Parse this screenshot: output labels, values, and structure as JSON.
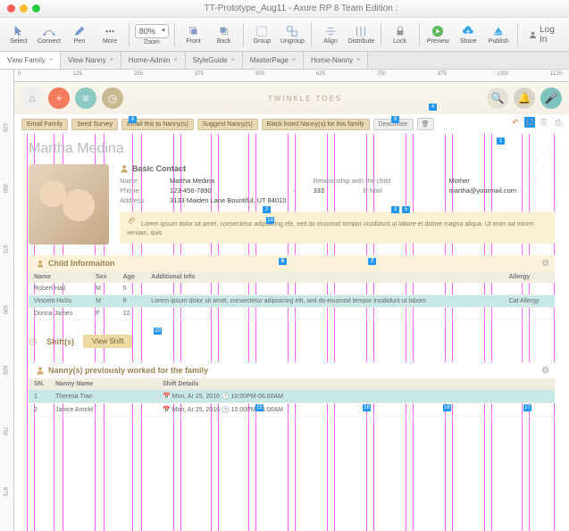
{
  "window": {
    "title": "TT-Prototype_Aug11 - Axure RP 8 Team Edition :"
  },
  "toolbar": {
    "select": "Select",
    "connect": "Connect",
    "pen": "Pen",
    "more": "More",
    "zoom": "80%",
    "zoom_lbl": "Zoom",
    "front": "Front",
    "back": "Back",
    "group": "Group",
    "ungroup": "Ungroup",
    "align": "Align",
    "distribute": "Distribute",
    "lock": "Lock",
    "preview": "Preview",
    "share": "Share",
    "publish": "Publish",
    "login": "Log In"
  },
  "tabs": [
    "View Family",
    "View Nanny",
    "Home-Admin",
    "StyleGuide",
    "MasterPage",
    "Home-Nanny"
  ],
  "ruler_h": [
    "0",
    "125",
    "250",
    "375",
    "500",
    "625",
    "750",
    "875",
    "1000",
    "1125"
  ],
  "ruler_v": [
    "125",
    "250",
    "375",
    "500",
    "625",
    "750",
    "875"
  ],
  "brand": "TWINKLE TOES",
  "action_buttons": {
    "email_family": "Email Family",
    "send_survey": "Send Survey",
    "email_nanny": "Email this to Nanny(s)",
    "suggest": "Suggest Nanny(s)",
    "blacklist": "Black listed Nanny(s) for this family",
    "deactivate": "Deactivate"
  },
  "person": {
    "name": "Martha Medina"
  },
  "basic": {
    "title": "Basic Contact",
    "name_lbl": "Name",
    "name": "Martha Medina",
    "rel_lbl": "Relationship with the child",
    "rel": "Mother",
    "phone_lbl": "Phone",
    "phone": "123-456-7890",
    "phone_sep": "-",
    "phone_ext": "333",
    "email_lbl": "E-Mail",
    "email": "martha@yourmail.com",
    "addr_lbl": "Address",
    "addr": "3133 Maiden Lane   Bountiful, UT 84010"
  },
  "note": "Lorem ipsum dolor sit amet, consectetur adipisicing elit, sed do eiusmod tempor incididunt ut labore et dolore magna aliqua. Ut enim ad minim veniam, quis",
  "children": {
    "title": "Child Informaiton",
    "headers": {
      "name": "Name",
      "sex": "Sex",
      "age": "Age",
      "info": "Additional Info",
      "allergy": "Allergy"
    },
    "rows": [
      {
        "name": "Robert Hall",
        "sex": "M",
        "age": "5",
        "info": "",
        "allergy": ""
      },
      {
        "name": "Vincent Hicks",
        "sex": "M",
        "age": "8",
        "info": "Lorem ipsum dolor sit amet, consectetur adipisicing elit, sed do eiusmod tempor incididunt ut labore",
        "allergy": "Cat Allergy"
      },
      {
        "name": "Donna James",
        "sex": "F",
        "age": "12",
        "info": "",
        "allergy": ""
      }
    ]
  },
  "shifts": {
    "title": "Shift(s)",
    "view": "View Shift"
  },
  "prev_nanny": {
    "title": "Nanny(s) previously worked for the family",
    "headers": {
      "sn": "SN.",
      "name": "Nanny Name",
      "details": "Shift Details"
    },
    "rows": [
      {
        "sn": "1",
        "name": "Theresa Tran",
        "date": "Mon, Ar 25, 2016",
        "time": "10:00PM-06:00AM"
      },
      {
        "sn": "2",
        "name": "Janice Arnold",
        "date": "Mon, Ar 25, 2016",
        "time": "10:00PM-06:00AM"
      }
    ]
  },
  "badges": {
    "b1": "1",
    "b2": "2",
    "b3": "3",
    "b4": "4",
    "b5": "5",
    "b6": "6",
    "b7": "7",
    "b8": "8",
    "b9": "9",
    "b12": "12",
    "b15": "15",
    "b16": "16",
    "b17": "17",
    "b18": "18",
    "b19": "19",
    "b20": "20"
  }
}
